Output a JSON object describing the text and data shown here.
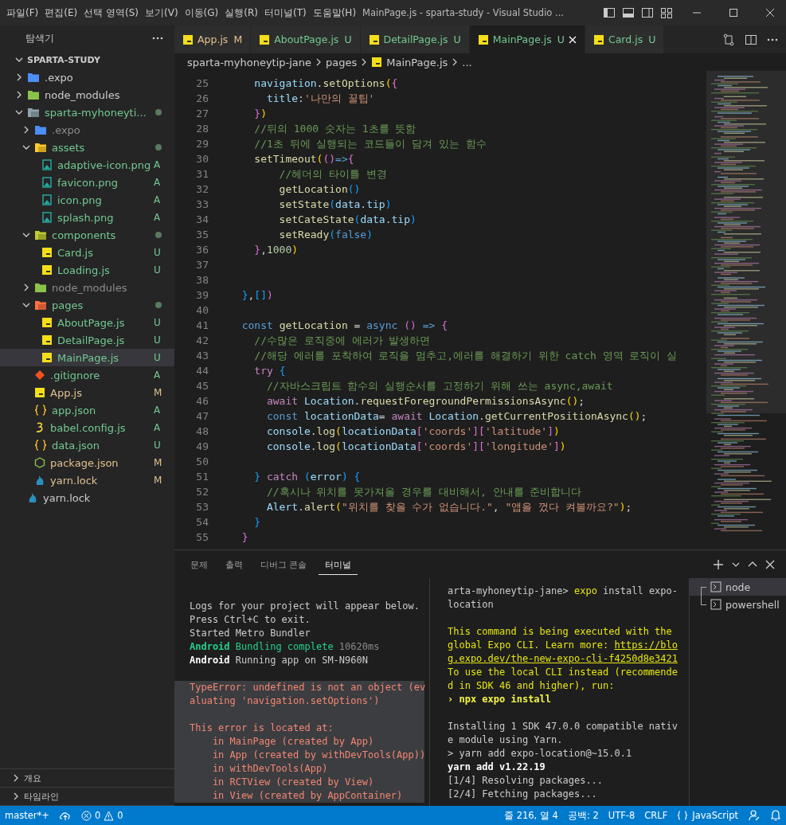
{
  "window": {
    "title": "MainPage.js - sparta-study - Visual Studio ..."
  },
  "menu": [
    "파일(F)",
    "편집(E)",
    "선택 영역(S)",
    "보기(V)",
    "이동(G)",
    "실행(R)",
    "터미널(T)",
    "도움말(H)"
  ],
  "sidebar": {
    "title": "탐색기",
    "root": {
      "label": "SPARTA-STUDY",
      "expanded": true
    },
    "tree": [
      {
        "name": ".expo",
        "kind": "expo-folder",
        "expanded": false,
        "selected": false,
        "color": "#cccccc"
      },
      {
        "name": "node_modules",
        "kind": "node-folder",
        "expanded": false,
        "selected": false,
        "color": "#cccccc"
      },
      {
        "name": "sparta-myhoneyti...",
        "kind": "folder",
        "expanded": true,
        "selected": false,
        "color": "#73c991",
        "dot": true,
        "children": [
          {
            "name": ".expo",
            "kind": "expo-folder",
            "expanded": false,
            "selected": false,
            "color": "#8c8c8c"
          },
          {
            "name": "assets",
            "kind": "assets-folder",
            "expanded": true,
            "selected": false,
            "color": "#73c991",
            "dot": true,
            "children": [
              {
                "name": "adaptive-icon.png",
                "kind": "image",
                "selected": false,
                "color": "#73c991",
                "badge": "A"
              },
              {
                "name": "favicon.png",
                "kind": "image",
                "selected": false,
                "color": "#73c991",
                "badge": "A"
              },
              {
                "name": "icon.png",
                "kind": "image",
                "selected": false,
                "color": "#73c991",
                "badge": "A"
              },
              {
                "name": "splash.png",
                "kind": "image",
                "selected": false,
                "color": "#73c991",
                "badge": "A"
              }
            ]
          },
          {
            "name": "components",
            "kind": "components-folder",
            "expanded": true,
            "selected": false,
            "color": "#73c991",
            "dot": true,
            "children": [
              {
                "name": "Card.js",
                "kind": "js",
                "selected": false,
                "color": "#73c991",
                "badge": "U"
              },
              {
                "name": "Loading.js",
                "kind": "js",
                "selected": false,
                "color": "#73c991",
                "badge": "U"
              }
            ]
          },
          {
            "name": "node_modules",
            "kind": "node-folder",
            "expanded": false,
            "selected": false,
            "color": "#8c8c8c"
          },
          {
            "name": "pages",
            "kind": "pages-folder",
            "expanded": true,
            "selected": false,
            "color": "#73c991",
            "dot": true,
            "children": [
              {
                "name": "AboutPage.js",
                "kind": "js",
                "selected": false,
                "color": "#73c991",
                "badge": "U"
              },
              {
                "name": "DetailPage.js",
                "kind": "js",
                "selected": false,
                "color": "#73c991",
                "badge": "U"
              },
              {
                "name": "MainPage.js",
                "kind": "js",
                "selected": true,
                "color": "#73c991",
                "badge": "U"
              }
            ]
          },
          {
            "name": ".gitignore",
            "kind": "git",
            "selected": false,
            "color": "#73c991",
            "badge": "A"
          },
          {
            "name": "App.js",
            "kind": "js",
            "selected": false,
            "color": "#e2c08d",
            "badge": "M"
          },
          {
            "name": "app.json",
            "kind": "json",
            "selected": false,
            "color": "#73c991",
            "badge": "A"
          },
          {
            "name": "babel.config.js",
            "kind": "babel",
            "selected": false,
            "color": "#73c991",
            "badge": "A"
          },
          {
            "name": "data.json",
            "kind": "json",
            "selected": false,
            "color": "#73c991",
            "badge": "U"
          },
          {
            "name": "package.json",
            "kind": "package",
            "selected": false,
            "color": "#e2c08d",
            "badge": "M"
          },
          {
            "name": "yarn.lock",
            "kind": "yarn",
            "selected": false,
            "color": "#e2c08d",
            "badge": "M"
          }
        ]
      },
      {
        "name": "yarn.lock",
        "kind": "yarn",
        "selected": false,
        "color": "#cccccc"
      }
    ],
    "sections": [
      {
        "label": "개요",
        "expanded": false
      },
      {
        "label": "타임라인",
        "expanded": false
      }
    ]
  },
  "tabs": [
    {
      "label": "App.js",
      "badge": "M",
      "color": "#e2c08d",
      "selected": false
    },
    {
      "label": "AboutPage.js",
      "badge": "U",
      "color": "#73c991",
      "selected": false
    },
    {
      "label": "DetailPage.js",
      "badge": "U",
      "color": "#73c991",
      "selected": false
    },
    {
      "label": "MainPage.js",
      "badge": "U",
      "color": "#73c991",
      "selected": true
    },
    {
      "label": "Card.js",
      "badge": "U",
      "color": "#73c991",
      "selected": false
    }
  ],
  "breadcrumb": [
    {
      "label": "sparta-myhoneytip-jane",
      "kind": "folder"
    },
    {
      "label": "pages",
      "kind": "folder"
    },
    {
      "label": "MainPage.js",
      "kind": "js"
    },
    {
      "label": "...",
      "kind": "more"
    }
  ],
  "code": [
    {
      "number": "25",
      "tokens": [
        {
          "kind": "var",
          "text": "    navigation"
        },
        {
          "kind": "plain",
          "text": "."
        },
        {
          "kind": "fn",
          "text": "setOptions"
        },
        {
          "kind": "b1",
          "text": "("
        },
        {
          "kind": "b2",
          "text": "{"
        }
      ]
    },
    {
      "number": "26",
      "tokens": [
        {
          "kind": "var",
          "text": "      title"
        },
        {
          "kind": "plain",
          "text": ":"
        },
        {
          "kind": "str",
          "text": "'나만의 꿀팁'"
        }
      ]
    },
    {
      "number": "27",
      "tokens": [
        {
          "kind": "b2",
          "text": "    }"
        },
        {
          "kind": "b1",
          "text": ")"
        }
      ]
    },
    {
      "number": "28",
      "tokens": [
        {
          "kind": "cmt",
          "text": "    //뒤의 1000 숫자는 1초를 뜻함"
        }
      ]
    },
    {
      "number": "29",
      "tokens": [
        {
          "kind": "cmt",
          "text": "    //1초 뒤에 실행되는 코드들이 담겨 있는 함수"
        }
      ]
    },
    {
      "number": "30",
      "tokens": [
        {
          "kind": "fn",
          "text": "    setTimeout"
        },
        {
          "kind": "b1",
          "text": "("
        },
        {
          "kind": "b2",
          "text": "()"
        },
        {
          "kind": "kw",
          "text": "=>"
        },
        {
          "kind": "b2",
          "text": "{"
        }
      ]
    },
    {
      "number": "31",
      "tokens": [
        {
          "kind": "cmt",
          "text": "        //헤더의 타이틀 변경"
        }
      ]
    },
    {
      "number": "32",
      "tokens": [
        {
          "kind": "fn",
          "text": "        getLocation"
        },
        {
          "kind": "b3",
          "text": "()"
        }
      ]
    },
    {
      "number": "33",
      "tokens": [
        {
          "kind": "fn",
          "text": "        setState"
        },
        {
          "kind": "b3",
          "text": "("
        },
        {
          "kind": "var",
          "text": "data.tip"
        },
        {
          "kind": "b3",
          "text": ")"
        }
      ]
    },
    {
      "number": "34",
      "tokens": [
        {
          "kind": "fn",
          "text": "        setCateState"
        },
        {
          "kind": "b3",
          "text": "("
        },
        {
          "kind": "var",
          "text": "data.tip"
        },
        {
          "kind": "b3",
          "text": ")"
        }
      ]
    },
    {
      "number": "35",
      "tokens": [
        {
          "kind": "fn",
          "text": "        setReady"
        },
        {
          "kind": "b3",
          "text": "("
        },
        {
          "kind": "kw",
          "text": "false"
        },
        {
          "kind": "b3",
          "text": ")"
        }
      ]
    },
    {
      "number": "36",
      "tokens": [
        {
          "kind": "b2",
          "text": "    }"
        },
        {
          "kind": "plain",
          "text": ","
        },
        {
          "kind": "num",
          "text": "1000"
        },
        {
          "kind": "b1",
          "text": ")"
        }
      ]
    },
    {
      "number": "37"
    },
    {
      "number": "38"
    },
    {
      "number": "39",
      "tokens": [
        {
          "kind": "b3",
          "text": "  }"
        },
        {
          "kind": "plain",
          "text": ","
        },
        {
          "kind": "b3",
          "text": "[]"
        },
        {
          "kind": "b2",
          "text": ")"
        }
      ]
    },
    {
      "number": "40"
    },
    {
      "number": "41",
      "tokens": [
        {
          "kind": "kw",
          "text": "  const "
        },
        {
          "kind": "fn",
          "text": "getLocation"
        },
        {
          "kind": "plain",
          "text": " = "
        },
        {
          "kind": "kw",
          "text": "async "
        },
        {
          "kind": "b2",
          "text": "()"
        },
        {
          "kind": "kw",
          "text": " => "
        },
        {
          "kind": "b2",
          "text": "{"
        }
      ]
    },
    {
      "number": "42",
      "tokens": [
        {
          "kind": "cmt",
          "text": "    //수많은 로직중에 에러가 발생하면"
        }
      ]
    },
    {
      "number": "43",
      "tokens": [
        {
          "kind": "cmt",
          "text": "    //해당 에러를 포착하여 로직을 멈추고,에러를 해결하기 위한 catch 영역 로직이 실"
        }
      ]
    },
    {
      "number": "44",
      "tokens": [
        {
          "kind": "ctl",
          "text": "    try "
        },
        {
          "kind": "b3",
          "text": "{"
        }
      ]
    },
    {
      "number": "45",
      "tokens": [
        {
          "kind": "cmt",
          "text": "      //자바스크립트 함수의 실행순서를 고정하기 위해 쓰는 async,await"
        }
      ]
    },
    {
      "number": "46",
      "tokens": [
        {
          "kind": "ctl",
          "text": "      await "
        },
        {
          "kind": "var",
          "text": "Location"
        },
        {
          "kind": "plain",
          "text": "."
        },
        {
          "kind": "fn",
          "text": "requestForegroundPermissionsAsync"
        },
        {
          "kind": "b1",
          "text": "()"
        },
        {
          "kind": "plain",
          "text": ";"
        }
      ]
    },
    {
      "number": "47",
      "tokens": [
        {
          "kind": "kw",
          "text": "      const "
        },
        {
          "kind": "var",
          "text": "locationData"
        },
        {
          "kind": "plain",
          "text": "= "
        },
        {
          "kind": "ctl",
          "text": "await "
        },
        {
          "kind": "var",
          "text": "Location"
        },
        {
          "kind": "plain",
          "text": "."
        },
        {
          "kind": "fn",
          "text": "getCurrentPositionAsync"
        },
        {
          "kind": "b1",
          "text": "()"
        },
        {
          "kind": "plain",
          "text": ";"
        }
      ]
    },
    {
      "number": "48",
      "tokens": [
        {
          "kind": "var",
          "text": "      console"
        },
        {
          "kind": "plain",
          "text": "."
        },
        {
          "kind": "fn",
          "text": "log"
        },
        {
          "kind": "b1",
          "text": "("
        },
        {
          "kind": "var",
          "text": "locationData"
        },
        {
          "kind": "b2",
          "text": "["
        },
        {
          "kind": "str",
          "text": "'coords'"
        },
        {
          "kind": "b2",
          "text": "]["
        },
        {
          "kind": "str",
          "text": "'latitude'"
        },
        {
          "kind": "b2",
          "text": "]"
        },
        {
          "kind": "b1",
          "text": ")"
        }
      ]
    },
    {
      "number": "49",
      "tokens": [
        {
          "kind": "var",
          "text": "      console"
        },
        {
          "kind": "plain",
          "text": "."
        },
        {
          "kind": "fn",
          "text": "log"
        },
        {
          "kind": "b1",
          "text": "("
        },
        {
          "kind": "var",
          "text": "locationData"
        },
        {
          "kind": "b2",
          "text": "["
        },
        {
          "kind": "str",
          "text": "'coords'"
        },
        {
          "kind": "b2",
          "text": "]["
        },
        {
          "kind": "str",
          "text": "'longitude'"
        },
        {
          "kind": "b2",
          "text": "]"
        },
        {
          "kind": "b1",
          "text": ")"
        }
      ]
    },
    {
      "number": "50"
    },
    {
      "number": "51",
      "tokens": [
        {
          "kind": "b3",
          "text": "    }"
        },
        {
          "kind": "ctl",
          "text": " catch "
        },
        {
          "kind": "b3",
          "text": "("
        },
        {
          "kind": "var",
          "text": "error"
        },
        {
          "kind": "b3",
          "text": ") {"
        }
      ]
    },
    {
      "number": "52",
      "tokens": [
        {
          "kind": "cmt",
          "text": "      //혹시나 위치를 못가져올 경우를 대비해서, 안내를 준비합니다"
        }
      ]
    },
    {
      "number": "53",
      "tokens": [
        {
          "kind": "var",
          "text": "      Alert"
        },
        {
          "kind": "plain",
          "text": "."
        },
        {
          "kind": "fn",
          "text": "alert"
        },
        {
          "kind": "b1",
          "text": "("
        },
        {
          "kind": "str",
          "text": "\"위치를 찾을 수가 없습니다.\""
        },
        {
          "kind": "plain",
          "text": ", "
        },
        {
          "kind": "str",
          "text": "\"앱을 껐다 켜볼까요?\""
        },
        {
          "kind": "b1",
          "text": ")"
        },
        {
          "kind": "plain",
          "text": ";"
        }
      ]
    },
    {
      "number": "54",
      "tokens": [
        {
          "kind": "b3",
          "text": "    }"
        }
      ]
    },
    {
      "number": "55",
      "tokens": [
        {
          "kind": "b2",
          "text": "  }"
        }
      ]
    }
  ],
  "panel": {
    "tabs": [
      {
        "label": "문제",
        "selected": false
      },
      {
        "label": "출력",
        "selected": false
      },
      {
        "label": "디버그 콘솔",
        "selected": false
      },
      {
        "label": "터미널",
        "selected": true
      }
    ],
    "left": [
      {
        "kind": "log",
        "lines": [
          [
            {
              "kind": "plain",
              "text": "Logs for your project will appear below."
            }
          ],
          [
            {
              "kind": "plain",
              "text": "Press Ctrl+C to exit."
            }
          ],
          [
            {
              "kind": "plain",
              "text": "Started Metro Bundler"
            }
          ],
          [
            {
              "kind": "greenbold",
              "text": "Android"
            },
            {
              "kind": "green",
              "text": " Bundling complete "
            },
            {
              "kind": "dim",
              "text": "10620ms"
            }
          ],
          [
            {
              "kind": "bold",
              "text": "Android"
            },
            {
              "kind": "plain",
              "text": " Running app on SM-N960N"
            }
          ]
        ]
      },
      {
        "kind": "error",
        "lines": [
          [
            {
              "kind": "red",
              "text": "TypeError: undefined is not an object (ev"
            }
          ],
          [
            {
              "kind": "red",
              "text": "aluating 'navigation.setOptions')"
            }
          ]
        ]
      },
      {
        "kind": "error",
        "lines": [
          [
            {
              "kind": "red",
              "text": "This error is located at:"
            }
          ],
          [
            {
              "kind": "red",
              "text": "    in MainPage (created by App)"
            }
          ],
          [
            {
              "kind": "red",
              "text": "    in App (created by withDevTools(App))"
            }
          ],
          [
            {
              "kind": "red",
              "text": "    in withDevTools(App)"
            }
          ],
          [
            {
              "kind": "red",
              "text": "    in RCTView (created by View)"
            }
          ],
          [
            {
              "kind": "red",
              "text": "    in View (created by AppContainer)"
            }
          ]
        ]
      }
    ],
    "right": [
      {
        "lines": [
          [
            {
              "kind": "plain",
              "text": "arta-myhoneytip-jane> "
            },
            {
              "kind": "yellow",
              "text": "expo"
            },
            {
              "kind": "plain",
              "text": " install expo-"
            }
          ],
          [
            {
              "kind": "plain",
              "text": "location"
            }
          ]
        ]
      },
      {
        "lines": [
          [
            {
              "kind": "yellow",
              "text": "This command is being executed with the"
            }
          ],
          [
            {
              "kind": "yellow",
              "text": "global Expo CLI. Learn more: "
            },
            {
              "kind": "link",
              "text": "https://blo"
            }
          ],
          [
            {
              "kind": "link",
              "text": "g.expo.dev/the-new-expo-cli-f4250d8e3421"
            }
          ],
          [
            {
              "kind": "yellow",
              "text": "To use the local CLI instead (recommende"
            }
          ],
          [
            {
              "kind": "yellow",
              "text": "d in SDK 46 and higher), run:"
            }
          ],
          [
            {
              "kind": "yellowbold",
              "text": "› npx expo install"
            }
          ]
        ]
      },
      {
        "lines": [
          [
            {
              "kind": "plain",
              "text": "Installing 1 SDK 47.0.0 compatible nativ"
            }
          ],
          [
            {
              "kind": "plain",
              "text": "e module using Yarn."
            }
          ],
          [
            {
              "kind": "plain",
              "text": "> yarn add expo-location@~15.0.1"
            }
          ],
          [
            {
              "kind": "bold",
              "text": "yarn add v1.22.19"
            }
          ],
          [
            {
              "kind": "plain",
              "text": "[1/4] Resolving packages..."
            }
          ],
          [
            {
              "kind": "plain",
              "text": "[2/4] Fetching packages..."
            }
          ]
        ]
      }
    ],
    "terminals": [
      {
        "label": "node",
        "selected": true
      },
      {
        "label": "powershell",
        "selected": false
      }
    ]
  },
  "status_bar": {
    "branch": "master*+",
    "errors": "0",
    "warnings": "0",
    "position": "줄 216, 열 4",
    "indent": "공백: 2",
    "encoding": "UTF-8",
    "eol": "CRLF",
    "language": "JavaScript"
  }
}
